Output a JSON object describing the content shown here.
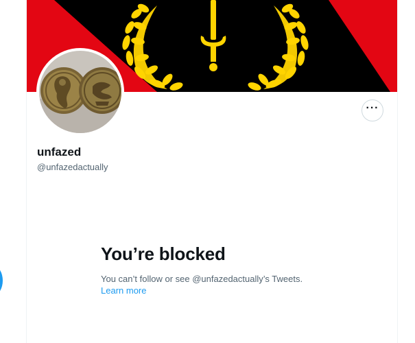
{
  "profile": {
    "display_name": "unfazed",
    "handle": "@unfazedactually",
    "more_label": "···"
  },
  "blocked": {
    "title": "You’re blocked",
    "message": "You can’t follow or see @unfazedactually’s Tweets.",
    "learn_more": "Learn more"
  },
  "colors": {
    "banner_red": "#e30613",
    "banner_black": "#000000",
    "banner_yellow": "#ffd400",
    "link_blue": "#1d9bf0",
    "secondary_text": "#536471"
  },
  "icons": {
    "avatar": "bronze-coins-image",
    "banner": "sword-laurel-emblem",
    "more": "more-horizontal-icon"
  }
}
